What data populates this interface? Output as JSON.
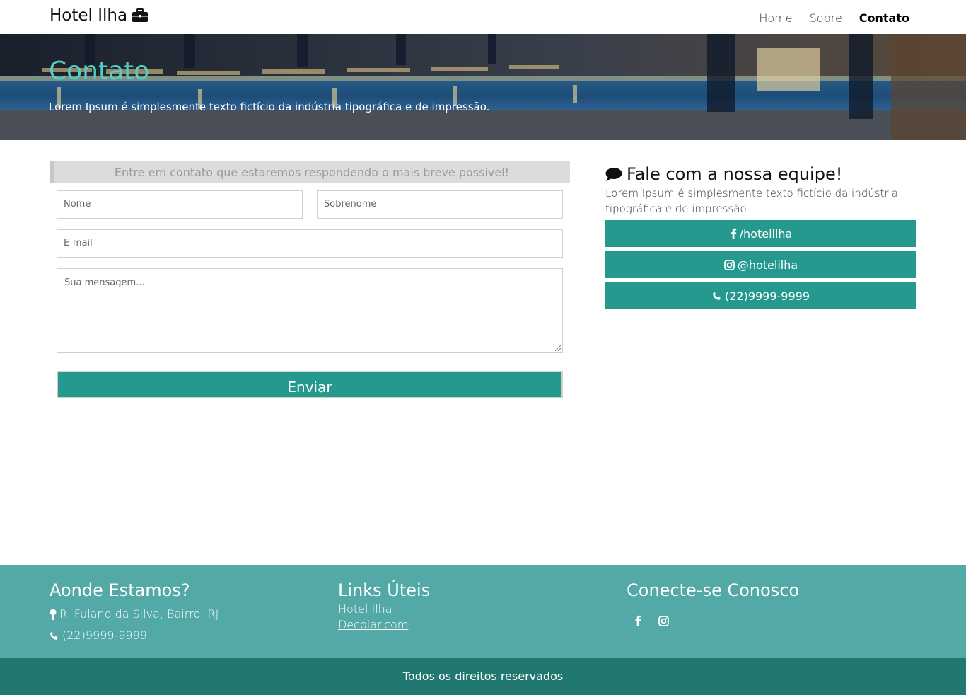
{
  "navbar": {
    "brand": "Hotel Ilha",
    "brand_icon": "briefcase-icon",
    "links": [
      {
        "label": "Home",
        "active": false
      },
      {
        "label": "Sobre",
        "active": false
      },
      {
        "label": "Contato",
        "active": true
      }
    ]
  },
  "hero": {
    "title": "Contato",
    "subtitle": "Lorem Ipsum é simplesmente texto fictício da indústria tipográfica e de impressão."
  },
  "form": {
    "notice": "Entre em contato que estaremos respondendo o mais breve possivel!",
    "first_name_placeholder": "Nome",
    "last_name_placeholder": "Sobrenome",
    "email_placeholder": "E-mail",
    "message_placeholder": "Sua mensagem...",
    "submit_label": "Enviar"
  },
  "contact": {
    "title": "Fale com a nossa equipe!",
    "title_icon": "comment-icon",
    "text": "Lorem Ipsum é simplesmente texto fictício da indústria tipográfica e de impressão.",
    "buttons": [
      {
        "label": "/hotelilha",
        "icon": "facebook-icon"
      },
      {
        "label": "@hotelilha",
        "icon": "instagram-icon"
      },
      {
        "label": "(22)9999-9999",
        "icon": "phone-icon"
      }
    ]
  },
  "footer": {
    "location_title": "Aonde Estamos?",
    "address": "R. Fulano da Silva, Bairro, RJ",
    "phone": "(22)9999-9999",
    "links_title": "Links Úteis",
    "links": [
      "Hotel Ilha",
      "Decolar.com"
    ],
    "connect_title": "Conecte-se Conosco",
    "copyright": "Todos os direitos reservados"
  },
  "colors": {
    "accent": "#25998e",
    "hero_title": "#4fd1c5",
    "footer": "#52a9a6",
    "footer_bottom": "#217870"
  }
}
